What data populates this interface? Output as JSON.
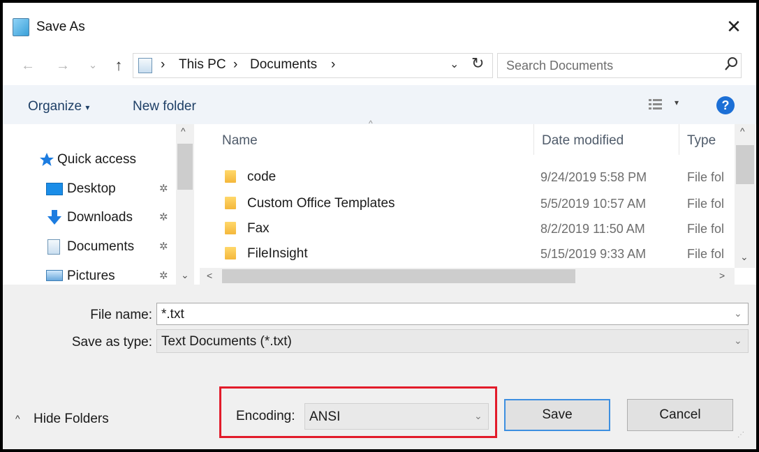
{
  "window": {
    "title": "Save As",
    "close_glyph": "✕",
    "icon": "notepad-icon"
  },
  "address": {
    "back_glyph": "←",
    "forward_glyph": "→",
    "recent_glyph": "⌄",
    "up_glyph": "↑",
    "sep_glyph": "›",
    "crumbs": [
      "This PC",
      "Documents"
    ],
    "dropdown_glyph": "⌄",
    "refresh_glyph": "↻",
    "search_placeholder": "Search Documents"
  },
  "toolbar": {
    "organize_label": "Organize",
    "organize_caret": "▾",
    "new_folder_label": "New folder",
    "view_caret": "▾",
    "help_glyph": "?"
  },
  "nav_pane": {
    "items": [
      {
        "label": "Quick access",
        "icon": "star-icon"
      },
      {
        "label": "Desktop",
        "icon": "desktop-icon",
        "pinned": true
      },
      {
        "label": "Downloads",
        "icon": "download-arrow-icon",
        "pinned": true
      },
      {
        "label": "Documents",
        "icon": "documents-icon",
        "pinned": true
      },
      {
        "label": "Pictures",
        "icon": "pictures-icon",
        "pinned": true
      }
    ],
    "pin_glyph": "📌"
  },
  "file_list": {
    "columns": [
      "Name",
      "Date modified",
      "Type"
    ],
    "sort_caret": "^",
    "rows": [
      {
        "name": "code",
        "date": "9/24/2019 5:58 PM",
        "type": "File fol"
      },
      {
        "name": "Custom Office Templates",
        "date": "5/5/2019 10:57 AM",
        "type": "File fol"
      },
      {
        "name": "Fax",
        "date": "8/2/2019 11:50 AM",
        "type": "File fol"
      },
      {
        "name": "FileInsight",
        "date": "5/15/2019 9:33 AM",
        "type": "File fol"
      }
    ]
  },
  "scroll_glyphs": {
    "up": "^",
    "down": "⌄",
    "left": "<",
    "right": ">"
  },
  "form": {
    "file_name_label": "File name:",
    "file_name_value": "*.txt",
    "save_type_label": "Save as type:",
    "save_type_value": "Text Documents (*.txt)",
    "encoding_label": "Encoding:",
    "encoding_value": "ANSI",
    "combo_chevron": "⌄"
  },
  "footer": {
    "hide_folders_caret": "^",
    "hide_folders_label": "Hide Folders",
    "save_label": "Save",
    "cancel_label": "Cancel"
  },
  "colors": {
    "highlight_border": "#e21b2a",
    "primary_button_border": "#3d8fe0",
    "help_blue": "#1c6fd6",
    "folder_yellow": "#f4b73b"
  }
}
